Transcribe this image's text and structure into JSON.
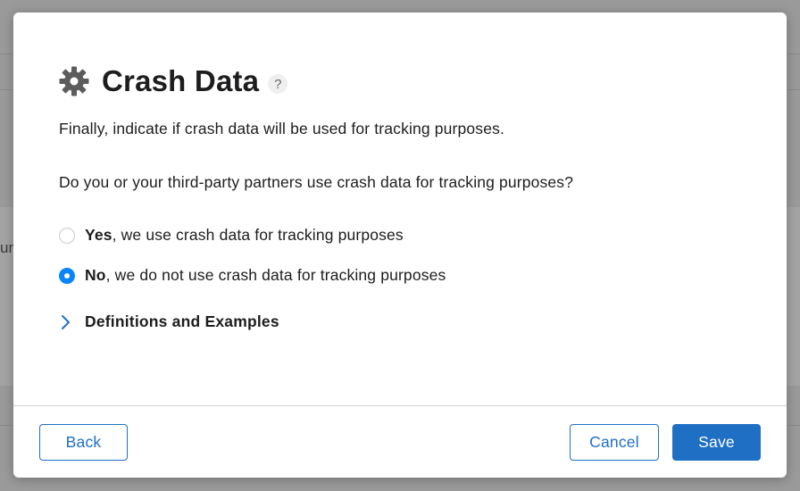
{
  "background": {
    "partial_text": "un"
  },
  "dialog": {
    "title": "Crash Data",
    "help_glyph": "?",
    "intro": "Finally, indicate if crash data will be used for tracking purposes.",
    "question": "Do you or your third-party partners use crash data for tracking purposes?",
    "options": [
      {
        "strong": "Yes",
        "rest": ", we use crash data for tracking purposes",
        "selected": false
      },
      {
        "strong": "No",
        "rest": ", we do not use crash data for tracking purposes",
        "selected": true
      }
    ],
    "disclosure_label": "Definitions and Examples"
  },
  "footer": {
    "back_label": "Back",
    "cancel_label": "Cancel",
    "save_label": "Save"
  },
  "colors": {
    "accent": "#1f6fc5",
    "radio_selected": "#0a84ff"
  },
  "icons": {
    "title": "gear-icon",
    "help": "help-icon",
    "disclosure": "chevron-right-icon"
  }
}
